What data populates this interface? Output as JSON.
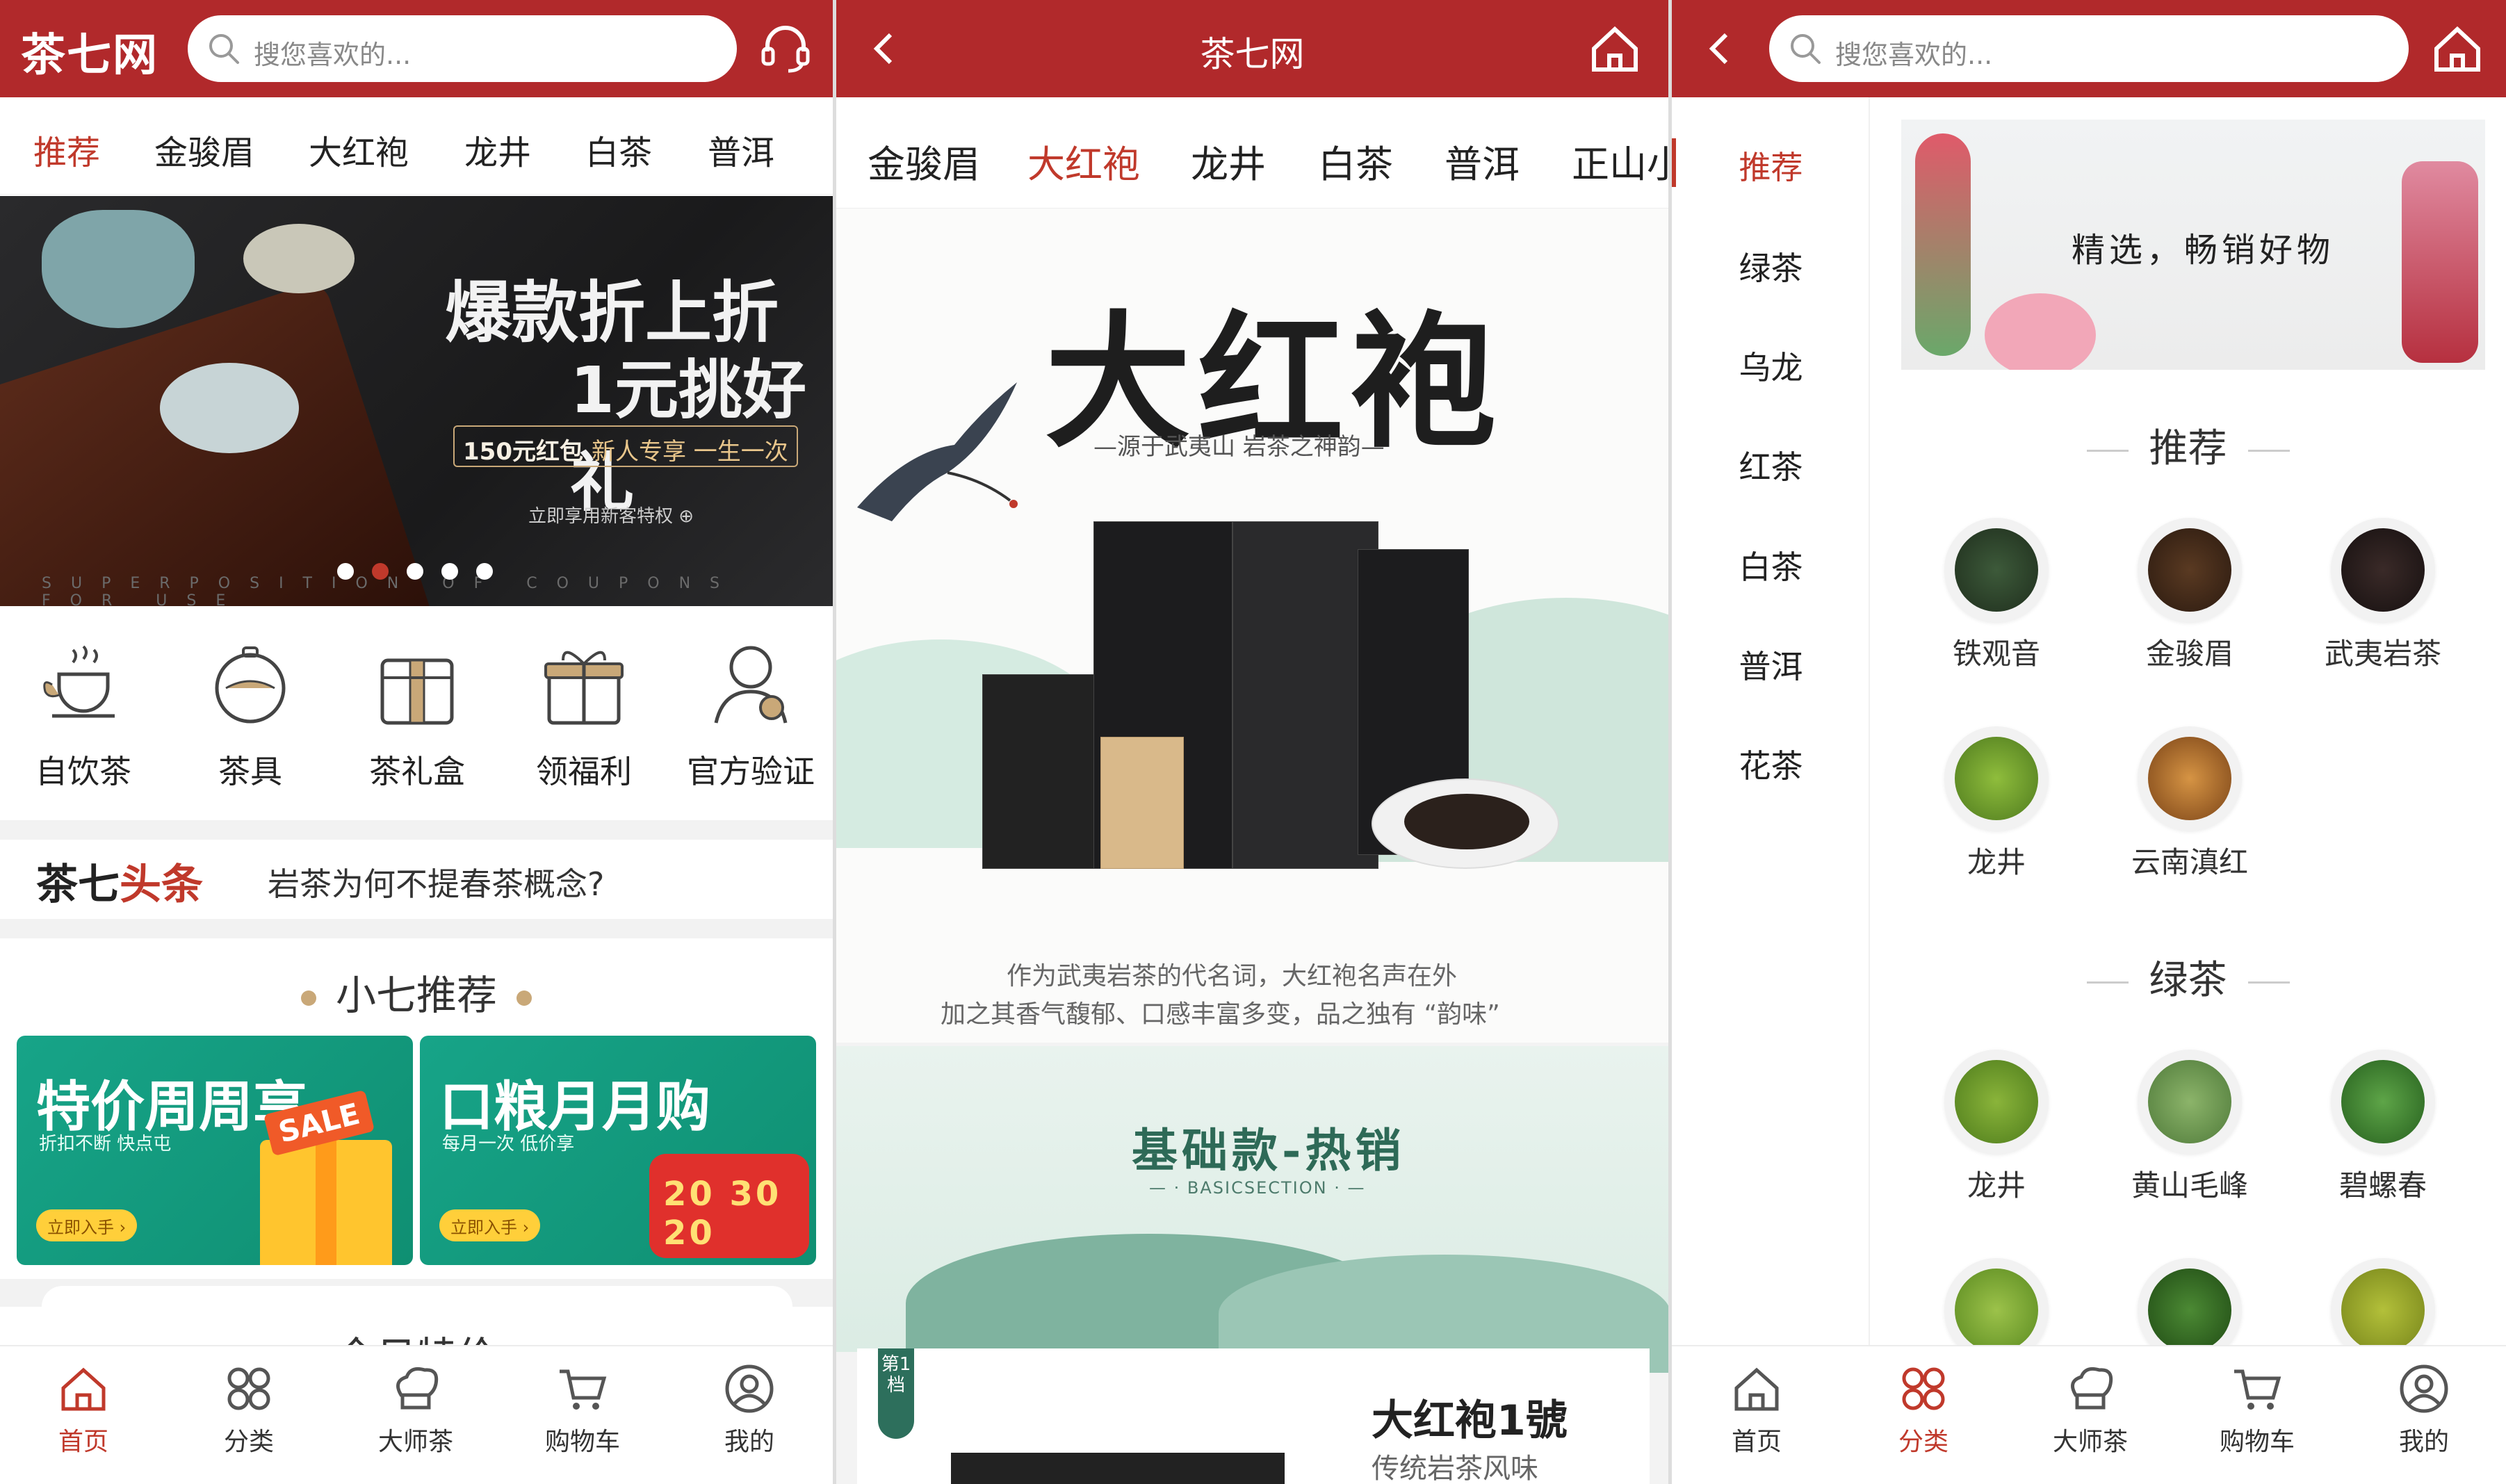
{
  "colors": {
    "brand": "#b1292b",
    "active": "#c0392b",
    "accent_gold": "#c9a878"
  },
  "panel1": {
    "header": {
      "logo": "茶七网",
      "search_placeholder": "搜您喜欢的..."
    },
    "tabs": [
      "推荐",
      "金骏眉",
      "大红袍",
      "龙井",
      "白茶",
      "普洱"
    ],
    "banner": {
      "headline1": "爆款折上折",
      "headline2": "1元挑好礼",
      "badge_a": "150元红包",
      "badge_b": "新人专享 一生一次",
      "sub": "立即享用新客特权 ⊕",
      "strip": "SUPERPOSITION OF COUPONS FOR USE",
      "dots_total": 5,
      "dots_active_index": 1
    },
    "icons": [
      {
        "label": "自饮茶",
        "icon": "tea-cup-icon"
      },
      {
        "label": "茶具",
        "icon": "teapot-icon"
      },
      {
        "label": "茶礼盒",
        "icon": "gift-box-icon"
      },
      {
        "label": "领福利",
        "icon": "present-icon"
      },
      {
        "label": "官方验证",
        "icon": "verified-user-icon"
      }
    ],
    "headline": {
      "logo_a": "茶七",
      "logo_b": "头条",
      "text": "岩茶为何不提春茶概念?"
    },
    "section_title": "小七推荐",
    "promos": [
      {
        "title": "特价周周享",
        "sub": "折扣不断  快点屯",
        "btn": "立即入手 ›",
        "tag": "SALE"
      },
      {
        "title": "口粮月月购",
        "sub": "每月一次  低价享",
        "btn": "立即入手 ›",
        "tag": "20 30 20"
      }
    ],
    "next_section": "今日特价"
  },
  "panel2": {
    "header": {
      "title": "茶七网"
    },
    "tabs": [
      "金骏眉",
      "大红袍",
      "龙井",
      "白茶",
      "普洱",
      "正山小"
    ],
    "active_tab": 1,
    "poster": {
      "title": "大红袍",
      "subtitle": "—源于武夷山 岩茶之神韵—",
      "body1": "作为武夷岩茶的代名词，大红袍名声在外",
      "body2": "加之其香气馥郁、口感丰富多变，品之独有 “韵味”"
    },
    "base": {
      "title": "基础款-热销",
      "sub": "— · BASICSECTION · —"
    },
    "card": {
      "badge": "第1档",
      "title": "大红袍1號",
      "sub": "传统岩茶风味"
    }
  },
  "panel3": {
    "header": {
      "search_placeholder": "搜您喜欢的..."
    },
    "sidebar": [
      "推荐",
      "绿茶",
      "乌龙",
      "红茶",
      "白茶",
      "普洱",
      "花茶"
    ],
    "sidebar_active": 0,
    "banner_text": "精选，畅销好物",
    "sections": [
      {
        "title": "推荐",
        "items": [
          "铁观音",
          "金骏眉",
          "武夷岩茶",
          "龙井",
          "云南滇红"
        ]
      },
      {
        "title": "绿茶",
        "items": [
          "龙井",
          "黄山毛峰",
          "碧螺春",
          "",
          "",
          ""
        ]
      }
    ]
  },
  "bottom_nav": [
    "首页",
    "分类",
    "大师茶",
    "购物车",
    "我的"
  ],
  "bottom_nav_active": {
    "panel1": 0,
    "panel3": 1
  }
}
